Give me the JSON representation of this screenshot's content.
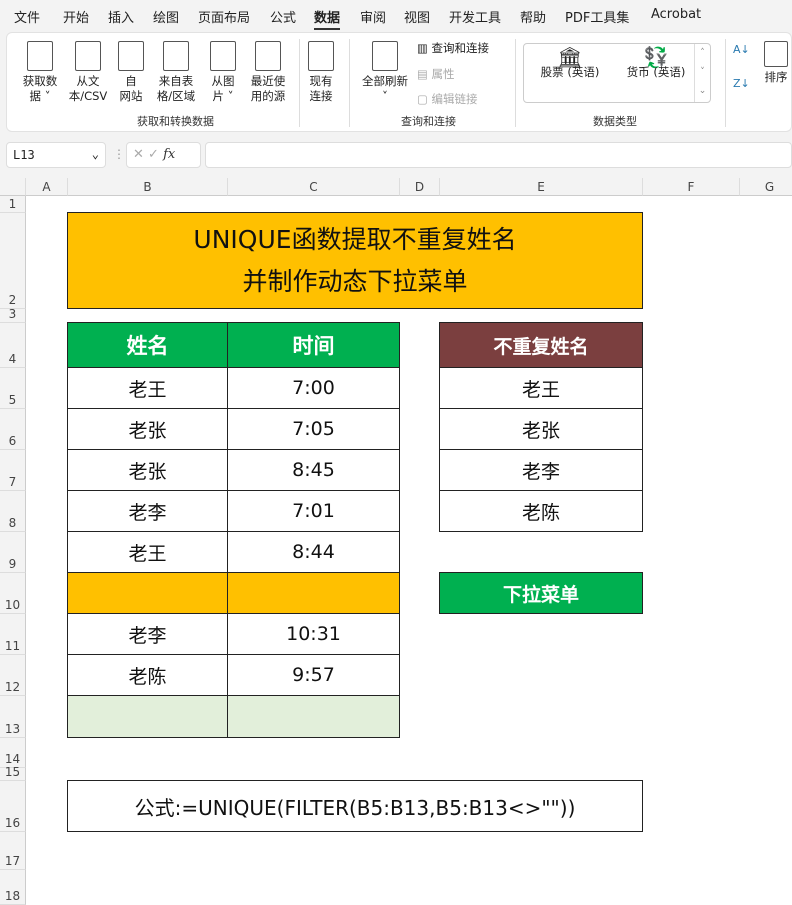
{
  "menu": [
    "文件",
    "开始",
    "插入",
    "绘图",
    "页面布局",
    "公式",
    "数据",
    "审阅",
    "视图",
    "开发工具",
    "帮助",
    "PDF工具集",
    "Acrobat"
  ],
  "ribbon": {
    "get_data": [
      "获取数",
      "据 ˅"
    ],
    "text_csv": [
      "从文",
      "本/CSV"
    ],
    "web": [
      "自",
      "网站"
    ],
    "table": [
      "来自表",
      "格/区域"
    ],
    "picture": [
      "从图",
      "片 ˅"
    ],
    "recent": [
      "最近使",
      "用的源"
    ],
    "existing": [
      "现有",
      "连接"
    ],
    "group1": "获取和转换数据",
    "refresh": [
      "全部刷新",
      "˅"
    ],
    "queries": "查询和连接",
    "properties": "属性",
    "edit_links": "编辑链接",
    "group2": "查询和连接",
    "stocks": "股票 (英语)",
    "currency": "货币 (英语)",
    "group3": "数据类型",
    "sort": "排序"
  },
  "namebox": "L13",
  "fx": "fx",
  "columns": [
    "A",
    "B",
    "C",
    "D",
    "E",
    "F",
    "G"
  ],
  "rows": [
    "1",
    "2",
    "3",
    "4",
    "5",
    "6",
    "7",
    "8",
    "9",
    "10",
    "11",
    "12",
    "13",
    "14",
    "15",
    "16",
    "17",
    "18"
  ],
  "title": [
    "UNIQUE函数提取不重复姓名",
    "并制作动态下拉菜单"
  ],
  "table": {
    "headers": [
      "姓名",
      "时间"
    ],
    "rows": [
      [
        "老王",
        "7:00"
      ],
      [
        "老张",
        "7:05"
      ],
      [
        "老张",
        "8:45"
      ],
      [
        "老李",
        "7:01"
      ],
      [
        "老王",
        "8:44"
      ],
      [
        "",
        ""
      ],
      [
        "老李",
        "10:31"
      ],
      [
        "老陈",
        "9:57"
      ],
      [
        "",
        ""
      ]
    ]
  },
  "unique": {
    "header": "不重复姓名",
    "values": [
      "老王",
      "老张",
      "老李",
      "老陈"
    ]
  },
  "dropdown_label": "下拉菜单",
  "formula": "公式:=UNIQUE(FILTER(B5:B13,B5:B13<>\"\"))",
  "colors": {
    "title_bg": "#FFC000",
    "header_green": "#00B050",
    "header_brown": "#7B3F3F",
    "blank_orange": "#FFC000",
    "blank_green": "#E2EFDA"
  }
}
